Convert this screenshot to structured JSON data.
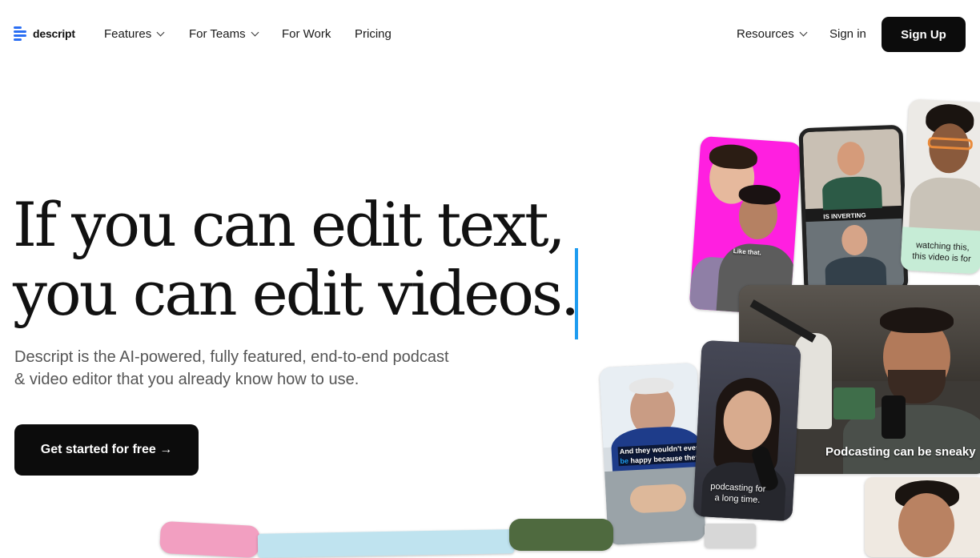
{
  "nav": {
    "logo_text": "descript",
    "items": [
      {
        "label": "Features",
        "has_dropdown": true
      },
      {
        "label": "For Teams",
        "has_dropdown": true
      },
      {
        "label": "For Work",
        "has_dropdown": false
      },
      {
        "label": "Pricing",
        "has_dropdown": false
      }
    ],
    "resources": {
      "label": "Resources",
      "has_dropdown": true
    },
    "sign_in": "Sign in",
    "sign_up": "Sign Up"
  },
  "hero": {
    "headline_line1": "If you can edit text,",
    "headline_line2": "you can edit videos.",
    "subtitle": "Descript is the AI-powered, fully featured, end-to-end podcast & video editor that you already know how to use.",
    "cta": "Get started for free →"
  },
  "collage": {
    "captions": {
      "like_that": "Like that.",
      "is_inverting": "IS INVERTING",
      "watching_line1": "watching this,",
      "watching_line2": "this video is for",
      "podcasting_sneaky": "Podcasting can be sneaky",
      "wouldnt_line1": "And they wouldn't ever",
      "wouldnt_word1": "be",
      "wouldnt_line2": "happy because they",
      "long_time_line1": "podcasting for",
      "long_time_line2": "a long time."
    }
  },
  "colors": {
    "accent": "#2b6ff3",
    "caret": "#1e9cf0",
    "button_bg": "#0c0c0c",
    "magenta": "#ff1fe0",
    "mint": "#c6ecd6"
  }
}
